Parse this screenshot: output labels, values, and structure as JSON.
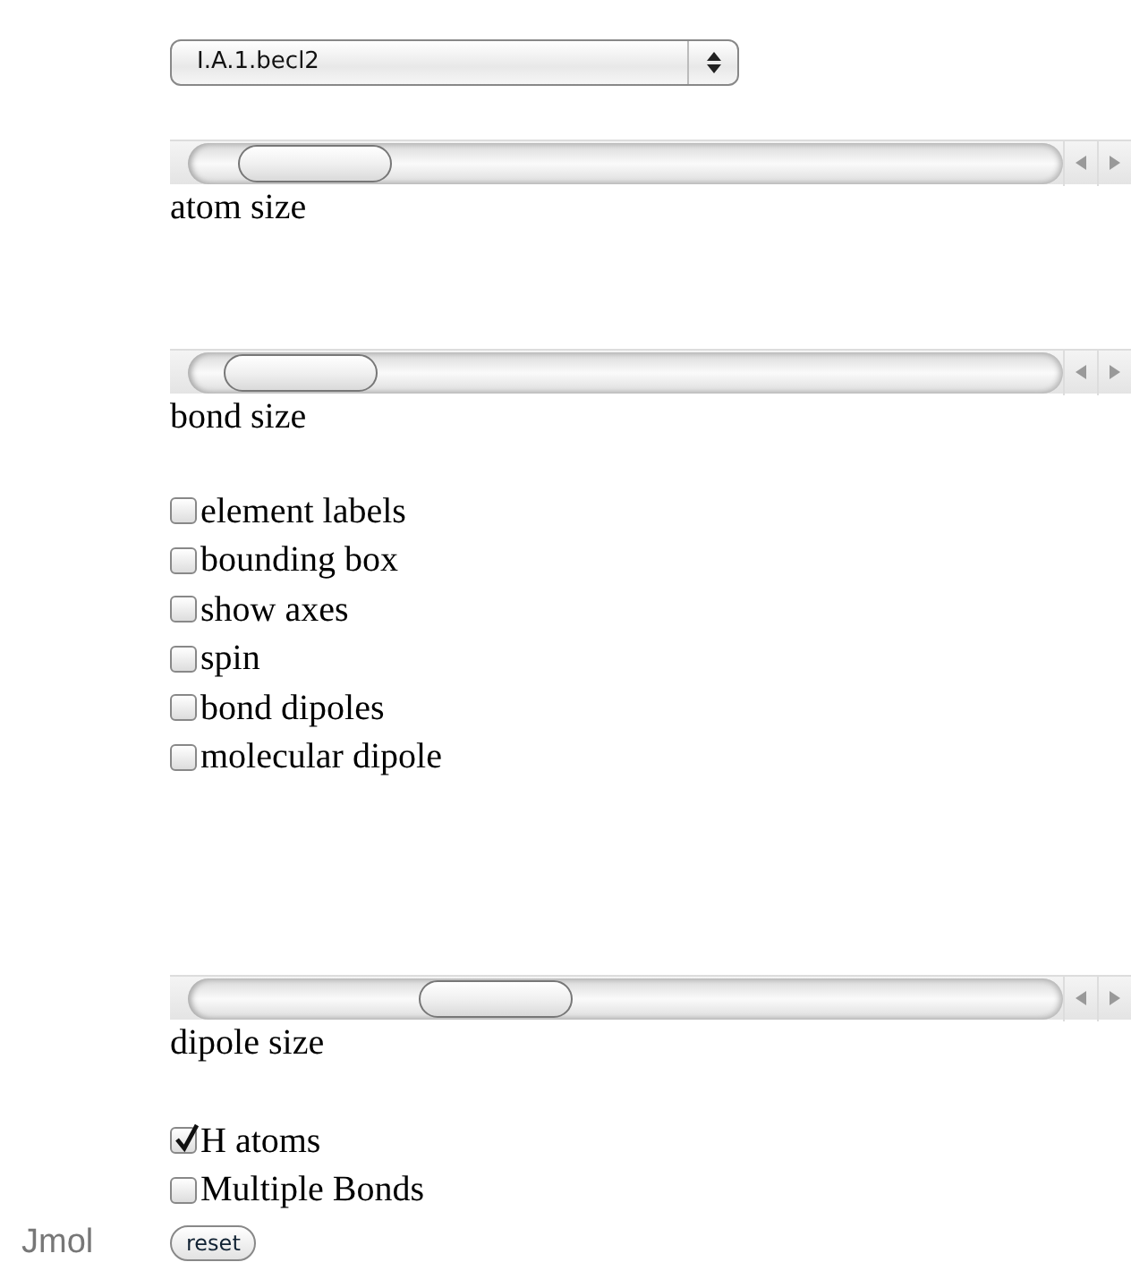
{
  "model_select": {
    "value": "I.A.1.becl2"
  },
  "groups": [
    {
      "items": [
        {
          "kind": "slider",
          "level": 0.07,
          "label": "atom size"
        }
      ]
    },
    {
      "items": [
        {
          "kind": "slider",
          "level": 0.05,
          "label": "bond size"
        }
      ]
    },
    {
      "items": [
        {
          "kind": "checkbox",
          "label": "element labels",
          "checked": false
        },
        {
          "kind": "checkbox",
          "label": "bounding box",
          "checked": false
        },
        {
          "kind": "checkbox",
          "label": "show axes",
          "checked": false
        },
        {
          "kind": "checkbox",
          "label": "spin",
          "checked": false
        },
        {
          "kind": "checkbox",
          "label": "bond dipoles",
          "checked": false
        },
        {
          "kind": "checkbox",
          "label": "molecular dipole",
          "checked": false
        }
      ]
    },
    {
      "items": [
        {
          "kind": "slider",
          "level": 0.32,
          "label": "dipole size"
        }
      ]
    },
    {
      "items": [
        {
          "kind": "checkbox",
          "label": "H atoms",
          "checked": true
        },
        {
          "kind": "checkbox",
          "label": "Multiple Bonds",
          "checked": false
        }
      ]
    }
  ],
  "footer": {
    "brand": "Jmol",
    "reset_button": "reset"
  }
}
